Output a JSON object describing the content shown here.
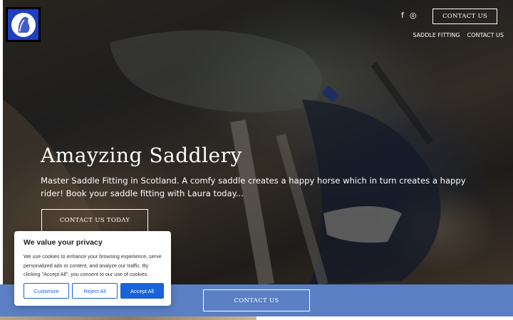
{
  "header": {
    "logo_icon": "horse-head-logo-icon",
    "social": [
      {
        "icon": "facebook-icon",
        "glyph": "f"
      },
      {
        "icon": "instagram-icon",
        "glyph": "◎"
      }
    ],
    "contact_label": "CONTACT US",
    "nav": [
      "SADDLE FITTING",
      "CONTACT US"
    ]
  },
  "hero": {
    "title": "Amayzing Saddlery",
    "subtitle": "Master Saddle Fitting in Scotland. A comfy saddle creates a happy horse which in turn creates a happy rider! Book your saddle fitting with Laura today...",
    "cta_label": "CONTACT US TODAY"
  },
  "band": {
    "button_label": "CONTACT US",
    "color": "#5a7fc4"
  },
  "cookie_banner": {
    "title": "We value your privacy",
    "text": "We use cookies to enhance your browsing experience, serve personalized ads or content, and analyze our traffic. By clicking \"Accept All\", you consent to our use of cookies.",
    "buttons": {
      "customize": "Customize",
      "reject": "Reject All",
      "accept": "Accept All"
    },
    "accent_color": "#1863dc"
  }
}
